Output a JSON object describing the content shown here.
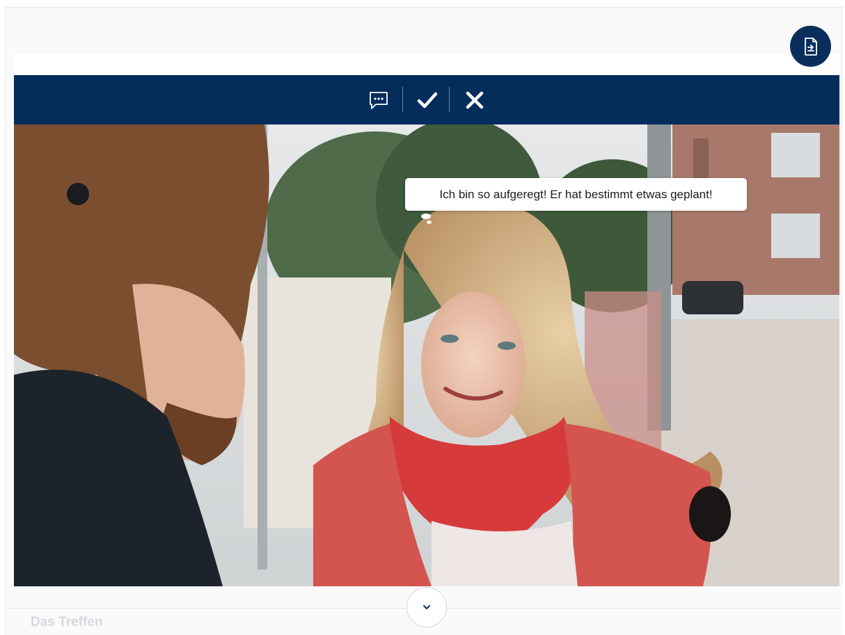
{
  "toolbar": {
    "comment_icon": "speech-bubble-dots-icon",
    "confirm_icon": "checkmark-icon",
    "close_icon": "close-x-icon",
    "background_color": "#042d5c"
  },
  "export_button": {
    "icon": "file-export-icon",
    "color": "#0a2e5c"
  },
  "video": {
    "subtitle_bubble": "Ich bin so aufgeregt! Er hat bestimmt etwas geplant!"
  },
  "footer": {
    "expand_icon": "chevron-down-icon",
    "section_title": "Das Treffen"
  }
}
